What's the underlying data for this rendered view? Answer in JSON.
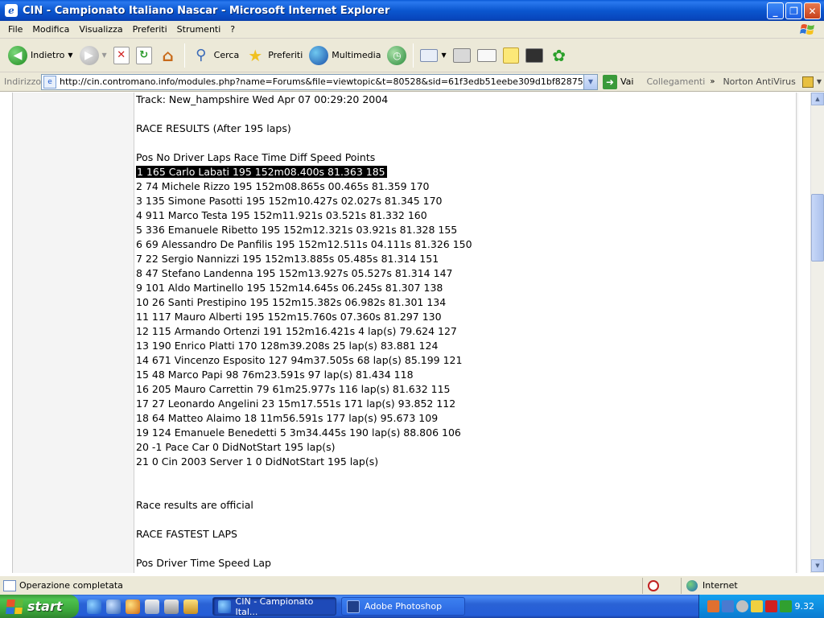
{
  "window": {
    "title": "CIN - Campionato Italiano Nascar - Microsoft Internet Explorer",
    "app_icon": "ie-icon"
  },
  "menu": {
    "items": [
      "File",
      "Modifica",
      "Visualizza",
      "Preferiti",
      "Strumenti",
      "?"
    ]
  },
  "toolbar": {
    "back_label": "Indietro",
    "search_label": "Cerca",
    "favorites_label": "Preferiti",
    "media_label": "Multimedia"
  },
  "address": {
    "label": "Indirizzo",
    "url": "http://cin.contromano.info/modules.php?name=Forums&file=viewtopic&t=80528&sid=61f3edb51eebe309d1bf828752fc4829",
    "go_label": "Vai",
    "links_label": "Collegamenti",
    "norton_label": "Norton AntiVirus"
  },
  "post": {
    "lines": [
      "Track: New_hampshire Wed Apr 07 00:29:20 2004",
      "",
      "RACE RESULTS (After 195 laps)",
      "",
      "Pos No Driver Laps Race Time Diff Speed Points",
      "1 165 Carlo Labati 195 152m08.400s 81.363 185",
      "2 74 Michele Rizzo 195 152m08.865s 00.465s 81.359 170",
      "3 135 Simone Pasotti 195 152m10.427s 02.027s 81.345 170",
      "4 911 Marco Testa 195 152m11.921s 03.521s 81.332 160",
      "5 336 Emanuele Ribetto 195 152m12.321s 03.921s 81.328 155",
      "6 69 Alessandro De Panfilis 195 152m12.511s 04.111s 81.326 150",
      "7 22 Sergio Nannizzi 195 152m13.885s 05.485s 81.314 151",
      "8 47 Stefano Landenna 195 152m13.927s 05.527s 81.314 147",
      "9 101 Aldo Martinello 195 152m14.645s 06.245s 81.307 138",
      "10 26 Santi Prestipino 195 152m15.382s 06.982s 81.301 134",
      "11 117 Mauro Alberti 195 152m15.760s 07.360s 81.297 130",
      "12 115 Armando Ortenzi 191 152m16.421s 4 lap(s) 79.624 127",
      "13 190 Enrico Platti 170 128m39.208s 25 lap(s) 83.881 124",
      "14 671 Vincenzo Esposito 127 94m37.505s 68 lap(s) 85.199 121",
      "15 48 Marco Papi 98 76m23.591s 97 lap(s) 81.434 118",
      "16 205 Mauro Carrettin 79 61m25.977s 116 lap(s) 81.632 115",
      "17 27 Leonardo Angelini 23 15m17.551s 171 lap(s) 93.852 112",
      "18 64 Matteo Alaimo 18 11m56.591s 177 lap(s) 95.673 109",
      "19 124 Emanuele Benedetti 5 3m34.445s 190 lap(s) 88.806 106",
      "20 -1 Pace Car 0 DidNotStart 195 lap(s)",
      "21 0 Cin 2003 Server 1 0 DidNotStart 195 lap(s)",
      "",
      "",
      "Race results are official",
      "",
      "RACE FASTEST LAPS",
      "",
      "Pos Driver Time Speed Lap"
    ],
    "highlighted_line_index": 5
  },
  "status": {
    "text": "Operazione completata",
    "zone": "Internet"
  },
  "taskbar": {
    "start_label": "start",
    "tasks": [
      {
        "label": "CIN - Campionato Ital...",
        "active": true
      },
      {
        "label": "Adobe Photoshop",
        "active": false
      }
    ],
    "clock": "9.32"
  }
}
